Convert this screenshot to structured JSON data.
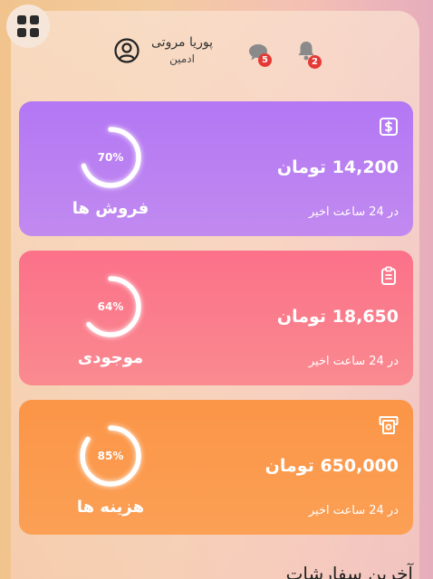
{
  "header": {
    "user_name": "پوریا مروتی",
    "user_role": "ادمین",
    "messages_badge": "5",
    "notifications_badge": "2"
  },
  "cards": [
    {
      "amount": "14,200 تومان",
      "subtitle": "در 24 ساعت اخیر",
      "label": "فروش ها",
      "percent": 70,
      "percent_label": "70%",
      "icon": "dollar-icon",
      "color": "#b377f4"
    },
    {
      "amount": "18,650 تومان",
      "subtitle": "در 24 ساعت اخیر",
      "label": "موجودی",
      "percent": 64,
      "percent_label": "64%",
      "icon": "clipboard-icon",
      "color": "#fb7189"
    },
    {
      "amount": "650,000 تومان",
      "subtitle": "در 24 ساعت اخیر",
      "label": "هزینه ها",
      "percent": 85,
      "percent_label": "85%",
      "icon": "cash-register-icon",
      "color": "#fb9547"
    }
  ],
  "section": {
    "title": "آخرین سفارشات"
  }
}
